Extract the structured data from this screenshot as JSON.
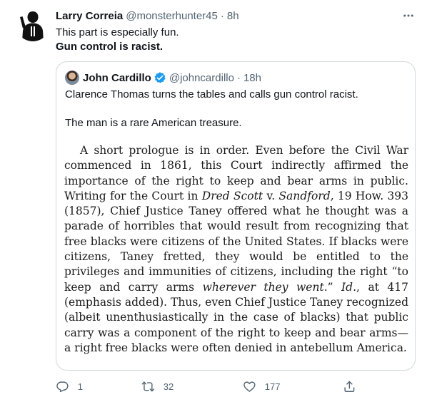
{
  "tweet": {
    "author_name": "Larry Correia",
    "author_handle": "@monsterhunter45",
    "separator": "·",
    "time": "8h",
    "line1": "This part is especially fun.",
    "line2": "Gun control is racist."
  },
  "quoted": {
    "author_name": "John Cardillo",
    "author_handle": "@johncardillo",
    "separator": "·",
    "time": "18h",
    "text1": "Clarence Thomas turns the tables and calls gun control racist.",
    "text2": "The man is a rare American treasure.",
    "excerpt": {
      "part1": "A short prologue is in order. Even before the Civil War commenced in 1861, this Court indirectly affirmed the importance of the right to keep and bear arms in public. Writing for the Court in ",
      "case_name": "Dred Scott",
      "v": " v. ",
      "case_name2": "Sandford",
      "part2": ", 19 How. 393 (1857), Chief Justice Taney offered what he thought was a parade of horribles that would result from recognizing that free blacks were citizens of the United States. If blacks were citizens, Taney fretted, they would be entitled to the privileges and immunities of citizens, including the right “to keep and carry arms ",
      "emph": "wherever they went",
      "part3": ".” ",
      "id": "Id.",
      "part4": ", at 417 (emphasis added). Thus, even Chief Justice Taney recognized (albeit unenthusiastically in the case of blacks) that public carry was a component of the right to keep and bear arms—a right free blacks were often denied in antebellum America."
    }
  },
  "actions": {
    "reply_count": "1",
    "retweet_count": "32",
    "like_count": "177"
  },
  "icons": {
    "more": "more-icon",
    "verified": "verified-badge-icon",
    "reply": "reply-icon",
    "retweet": "retweet-icon",
    "like": "heart-icon",
    "share": "share-icon"
  },
  "colors": {
    "text_primary": "#0f1419",
    "text_secondary": "#536471",
    "verified_blue": "#1d9bf0",
    "border": "#cfd9de"
  }
}
